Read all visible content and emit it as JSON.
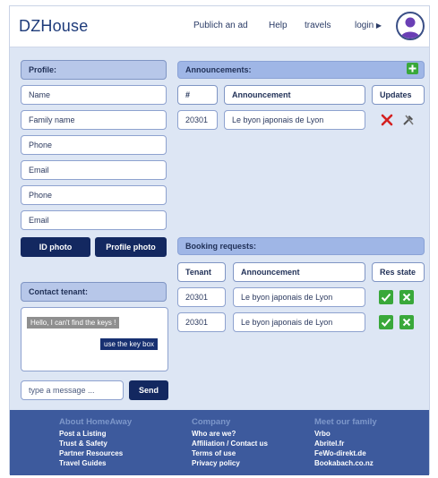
{
  "header": {
    "brand": "DZHouse",
    "nav": {
      "publish": "Publich an ad",
      "help": "Help",
      "travels": "travels",
      "login": "login",
      "login_arrow": "▶"
    }
  },
  "profile": {
    "title": "Profile:",
    "fields": {
      "name": "Name",
      "family_name": "Family name",
      "phone1": "Phone",
      "email1": "Email",
      "phone2": "Phone",
      "email2": "Email"
    },
    "buttons": {
      "id_photo": "ID photo",
      "profile_photo": "Profile photo"
    }
  },
  "contact": {
    "title": "Contact tenant:",
    "messages": {
      "incoming": "Hello, I can't find the keys !",
      "outgoing": "use the key box"
    },
    "input_placeholder": "type a message ...",
    "send_label": "Send"
  },
  "announcements": {
    "title": "Announcements:",
    "add_icon": "plus-icon",
    "columns": {
      "id": "#",
      "announcement": "Announcement",
      "updates": "Updates"
    },
    "rows": [
      {
        "id": "20301",
        "title": "Le byon japonais de Lyon"
      }
    ]
  },
  "bookings": {
    "title": "Booking requests:",
    "columns": {
      "tenant": "Tenant",
      "announcement": "Announcement",
      "res_state": "Res state"
    },
    "rows": [
      {
        "tenant": "20301",
        "announcement": "Le byon japonais de Lyon"
      },
      {
        "tenant": "20301",
        "announcement": "Le byon japonais de Lyon"
      }
    ]
  },
  "footer": {
    "about": {
      "title": "About HomeAway",
      "links": [
        "Post a Listing",
        "Trust & Safety",
        "Partner Resources",
        "Travel Guides"
      ]
    },
    "company": {
      "title": "Company",
      "links": [
        "Who are we?",
        "Affiliation / Contact us",
        "Terms of use",
        "Privacy policy"
      ]
    },
    "family": {
      "title": "Meet our family",
      "links": [
        "Vrbo",
        "Abritel.fr",
        "FeWo-direkt.de",
        "Bookabach.co.nz"
      ]
    }
  },
  "colors": {
    "primary_dark": "#132860",
    "panel_bg": "#dde6f4",
    "footer_bg": "#3d5a9d",
    "accept_green": "#39a83a",
    "delete_red": "#d42020"
  }
}
